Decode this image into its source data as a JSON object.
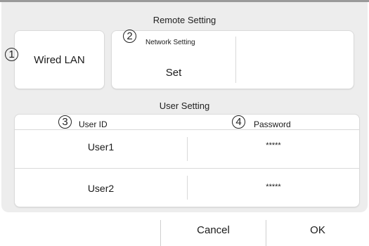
{
  "remote": {
    "title": "Remote Setting",
    "wired_lan": "Wired LAN",
    "network_setting": {
      "title": "Network Setting",
      "value": "Set"
    }
  },
  "user": {
    "title": "User Setting",
    "headers": {
      "user_id": "User ID",
      "password": "Password"
    },
    "rows": [
      {
        "user_id": "User1",
        "password": "*****"
      },
      {
        "user_id": "User2",
        "password": "*****"
      }
    ]
  },
  "callouts": [
    "1",
    "2",
    "3",
    "4"
  ],
  "buttons": {
    "blank": "",
    "cancel": "Cancel",
    "ok": "OK"
  }
}
